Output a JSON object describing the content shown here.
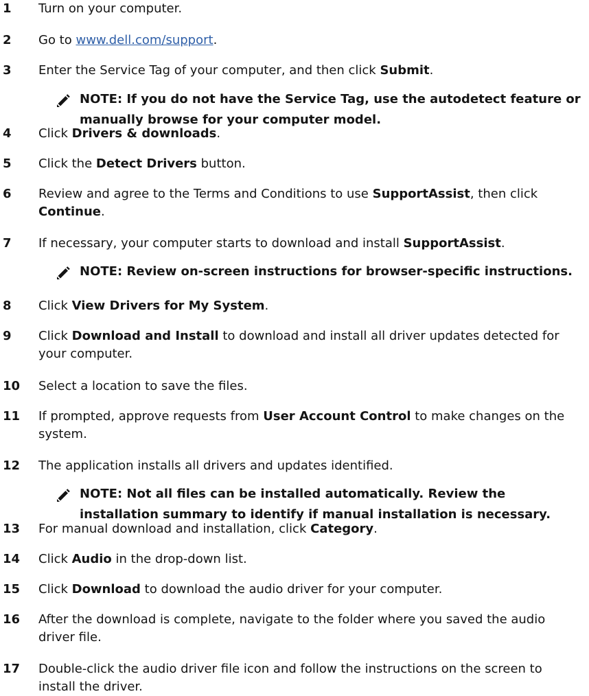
{
  "steps": [
    {
      "num": "1",
      "parts": [
        {
          "t": "Turn on your computer."
        }
      ]
    },
    {
      "num": "2",
      "parts": [
        {
          "t": "Go to "
        },
        {
          "t": "www.dell.com/support",
          "link": true
        },
        {
          "t": "."
        }
      ]
    },
    {
      "num": "3",
      "parts": [
        {
          "t": "Enter the Service Tag of your computer, and then click "
        },
        {
          "t": "Submit",
          "b": true
        },
        {
          "t": "."
        }
      ],
      "note": "NOTE: If you do not have the Service Tag, use the autodetect feature or manually browse for your computer model."
    },
    {
      "num": "4",
      "parts": [
        {
          "t": "Click "
        },
        {
          "t": "Drivers & downloads",
          "b": true
        },
        {
          "t": "."
        }
      ]
    },
    {
      "num": "5",
      "parts": [
        {
          "t": "Click the "
        },
        {
          "t": "Detect Drivers",
          "b": true
        },
        {
          "t": " button."
        }
      ]
    },
    {
      "num": "6",
      "parts": [
        {
          "t": "Review and agree to the Terms and Conditions to use "
        },
        {
          "t": "SupportAssist",
          "b": true
        },
        {
          "t": ", then click "
        },
        {
          "t": "Continue",
          "b": true
        },
        {
          "t": "."
        }
      ]
    },
    {
      "num": "7",
      "parts": [
        {
          "t": "If necessary, your computer starts to download and install "
        },
        {
          "t": "SupportAssist",
          "b": true
        },
        {
          "t": "."
        }
      ],
      "note": "NOTE: Review on-screen instructions for browser-specific instructions."
    },
    {
      "num": "8",
      "parts": [
        {
          "t": "Click "
        },
        {
          "t": "View Drivers for My System",
          "b": true
        },
        {
          "t": "."
        }
      ]
    },
    {
      "num": "9",
      "parts": [
        {
          "t": "Click "
        },
        {
          "t": "Download and Install",
          "b": true
        },
        {
          "t": " to download and install all driver updates detected for your computer."
        }
      ]
    },
    {
      "num": "10",
      "parts": [
        {
          "t": "Select a location to save the files."
        }
      ]
    },
    {
      "num": "11",
      "parts": [
        {
          "t": "If prompted, approve requests from "
        },
        {
          "t": "User Account Control",
          "b": true
        },
        {
          "t": " to make changes on the system."
        }
      ]
    },
    {
      "num": "12",
      "parts": [
        {
          "t": "The application installs all drivers and updates identified."
        }
      ],
      "note": "NOTE: Not all files can be installed automatically. Review the installation summary to identify if manual installation is necessary."
    },
    {
      "num": "13",
      "parts": [
        {
          "t": "For manual download and installation, click "
        },
        {
          "t": "Category",
          "b": true
        },
        {
          "t": "."
        }
      ]
    },
    {
      "num": "14",
      "parts": [
        {
          "t": "Click "
        },
        {
          "t": "Audio",
          "b": true
        },
        {
          "t": " in the drop-down list."
        }
      ]
    },
    {
      "num": "15",
      "parts": [
        {
          "t": "Click "
        },
        {
          "t": "Download",
          "b": true
        },
        {
          "t": " to download the audio driver for your computer."
        }
      ]
    },
    {
      "num": "16",
      "parts": [
        {
          "t": "After the download is complete, navigate to the folder where you saved the audio driver file."
        }
      ]
    },
    {
      "num": "17",
      "parts": [
        {
          "t": "Double-click the audio driver file icon and follow the instructions on the screen to install the driver."
        }
      ]
    }
  ],
  "icons": {
    "note": "note-pencil-icon"
  },
  "colors": {
    "text": "#141414",
    "link": "#2f5fa8"
  }
}
